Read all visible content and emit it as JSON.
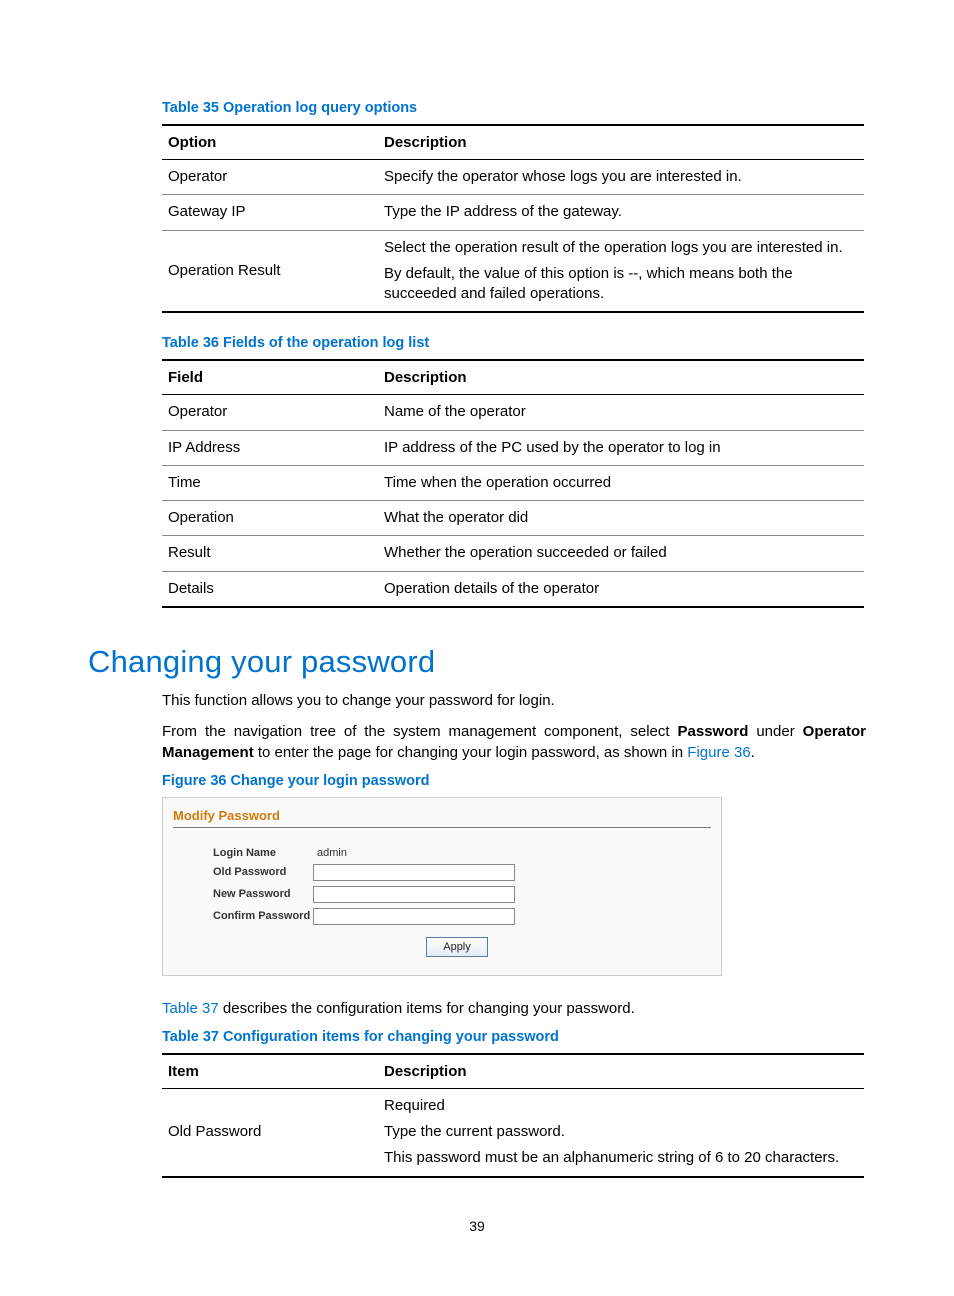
{
  "table35": {
    "caption": "Table 35 Operation log query options",
    "headers": [
      "Option",
      "Description"
    ],
    "rows": [
      [
        "Operator",
        "Specify the operator whose logs you are interested in."
      ],
      [
        "Gateway IP",
        "Type the IP address of the gateway."
      ],
      [
        "Operation Result",
        [
          "Select the operation result of the operation logs you are interested in.",
          "By default, the value of this option is --, which means both the succeeded and failed operations."
        ]
      ]
    ]
  },
  "table36": {
    "caption": "Table 36 Fields of the operation log list",
    "headers": [
      "Field",
      "Description"
    ],
    "rows": [
      [
        "Operator",
        "Name of the operator"
      ],
      [
        "IP Address",
        "IP address of the PC used by the operator to log in"
      ],
      [
        "Time",
        "Time when the operation occurred"
      ],
      [
        "Operation",
        "What the operator did"
      ],
      [
        "Result",
        "Whether the operation succeeded or failed"
      ],
      [
        "Details",
        "Operation details of the operator"
      ]
    ]
  },
  "section": {
    "heading": "Changing your password",
    "p1": "This function allows you to change your password for login.",
    "p2_a": "From the navigation tree of the system management component, select ",
    "p2_b": "Password",
    "p2_c": " under ",
    "p2_d": "Operator Management",
    "p2_e": " to enter the page for changing your login password, as shown in ",
    "p2_link": "Figure 36",
    "p2_f": "."
  },
  "figure36": {
    "caption": "Figure 36 Change your login password",
    "title": "Modify Password",
    "login_name_label": "Login Name",
    "login_name_value": "admin",
    "old_pw_label": "Old Password",
    "new_pw_label": "New Password",
    "confirm_pw_label": "Confirm Password",
    "apply": "Apply"
  },
  "para_after_fig_a": "Table 37",
  "para_after_fig_b": " describes the configuration items for changing your password.",
  "table37": {
    "caption": "Table 37 Configuration items for changing your password",
    "headers": [
      "Item",
      "Description"
    ],
    "rows": [
      [
        "Old Password",
        [
          "Required",
          "Type the current password.",
          "This password must be an alphanumeric string of 6 to 20 characters."
        ]
      ]
    ]
  },
  "page_number": "39"
}
